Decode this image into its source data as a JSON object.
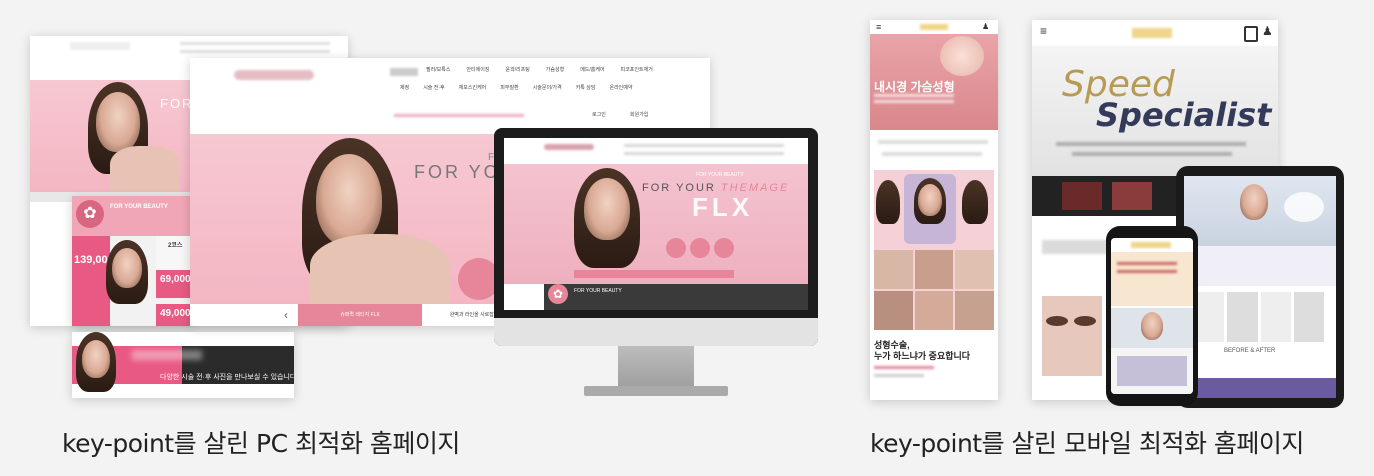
{
  "captions": {
    "pc": "key-point를 살린 PC 최적화 홈페이지",
    "mobile": "key-point를 살린 모바일 최적화 홈페이지"
  },
  "pc": {
    "front": {
      "nav_row1": [
        "필러/보톡스",
        "안티에이징",
        "윤곽/리프팅",
        "가슴성형",
        "메드/홈케어",
        "피코포인트재거"
      ],
      "nav_row2": [
        "제정",
        "시술 전·후",
        "재모스킨케어",
        "피부질환",
        "시술문의/가격",
        "카톡 상담",
        "온라인예약"
      ],
      "login": "로그인",
      "join": "회원가입",
      "hero_text": "FOR YOUR",
      "hero_letter": "F",
      "tab_active": "슈퍼퀵 레티지 FLX",
      "tab_inactive": "완벽과 라인을 사로잡는 샹티라인"
    },
    "back": {
      "hero_text": "FOR YO"
    },
    "monitor": {
      "beauty_small": "FOR YOUR BEAUTY",
      "hero_line1": "FOR YOUR",
      "hero_accent": "THEMAGE",
      "hero_big": "FLX",
      "promo_beauty": "FOR YOUR BEAUTY"
    },
    "promo_card": {
      "beauty": "FOR YOUR BEAUTY",
      "price_1": "139,000",
      "price_2": "69,000",
      "price_3": "49,000",
      "label_2": "2코스"
    },
    "banner": {
      "text": "다양한 시술 전·후 사진을 만나보실 수 있습니다"
    }
  },
  "mobile": {
    "left_phone": {
      "menu_icon": "≡",
      "hero_title": "내시경 가슴성형",
      "bottom_title_1": "성형수술,",
      "bottom_title_2": "누가 하느냐가 중요합니다"
    },
    "tablet": {
      "title_1": "Speed",
      "title_2": "Specialist",
      "menu_icon": "≡"
    },
    "ipad": {
      "footer": "BEFORE & AFTER"
    }
  },
  "colors": {
    "background": "#f3f3f3",
    "brand_pink": "#e7859a",
    "hero_pink": "#f4b6c3",
    "dark": "#2b2b2b",
    "purple": "#6b5aa0"
  }
}
